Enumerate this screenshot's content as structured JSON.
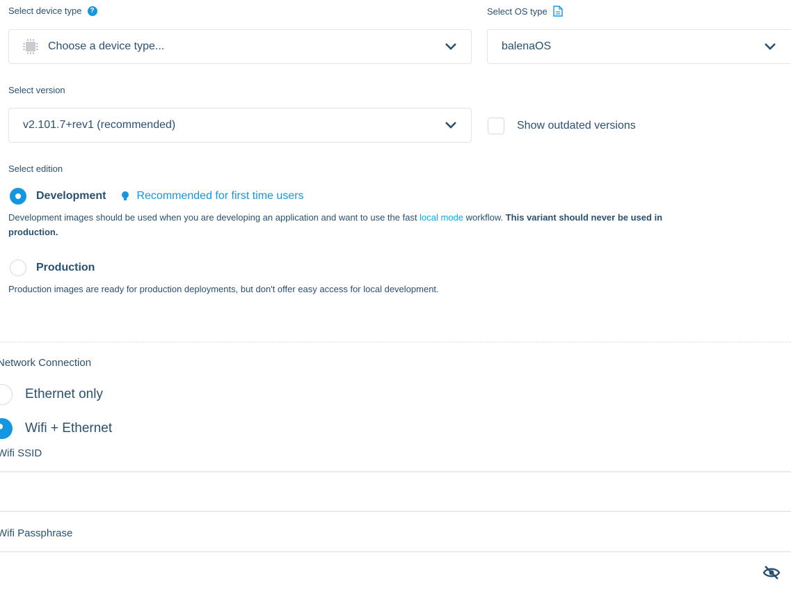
{
  "device_type": {
    "label": "Select device type",
    "placeholder": "Choose a device type..."
  },
  "os_type": {
    "label": "Select OS type",
    "value": "balenaOS"
  },
  "version": {
    "label": "Select version",
    "value": "v2.101.7+rev1 (recommended)",
    "show_outdated_label": "Show outdated versions"
  },
  "edition": {
    "label": "Select edition",
    "development": {
      "title": "Development",
      "tip": "Recommended for first time users",
      "desc_pre": "Development images should be used when you are developing an application and want to use the fast ",
      "desc_link": "local mode",
      "desc_mid": " workflow. ",
      "desc_bold_line1": "This variant should never be used in",
      "desc_bold_line2": "production."
    },
    "production": {
      "title": "Production",
      "desc": "Production images are ready for production deployments, but don't offer easy access for local development."
    }
  },
  "network": {
    "label": "Network Connection",
    "ethernet_only": "Ethernet only",
    "wifi_ethernet": "Wifi + Ethernet",
    "ssid_label": "Wifi SSID",
    "passphrase_label": "Wifi Passphrase"
  },
  "colors": {
    "accent": "#1496e1",
    "text": "#2a506f",
    "link": "#00aeef"
  }
}
